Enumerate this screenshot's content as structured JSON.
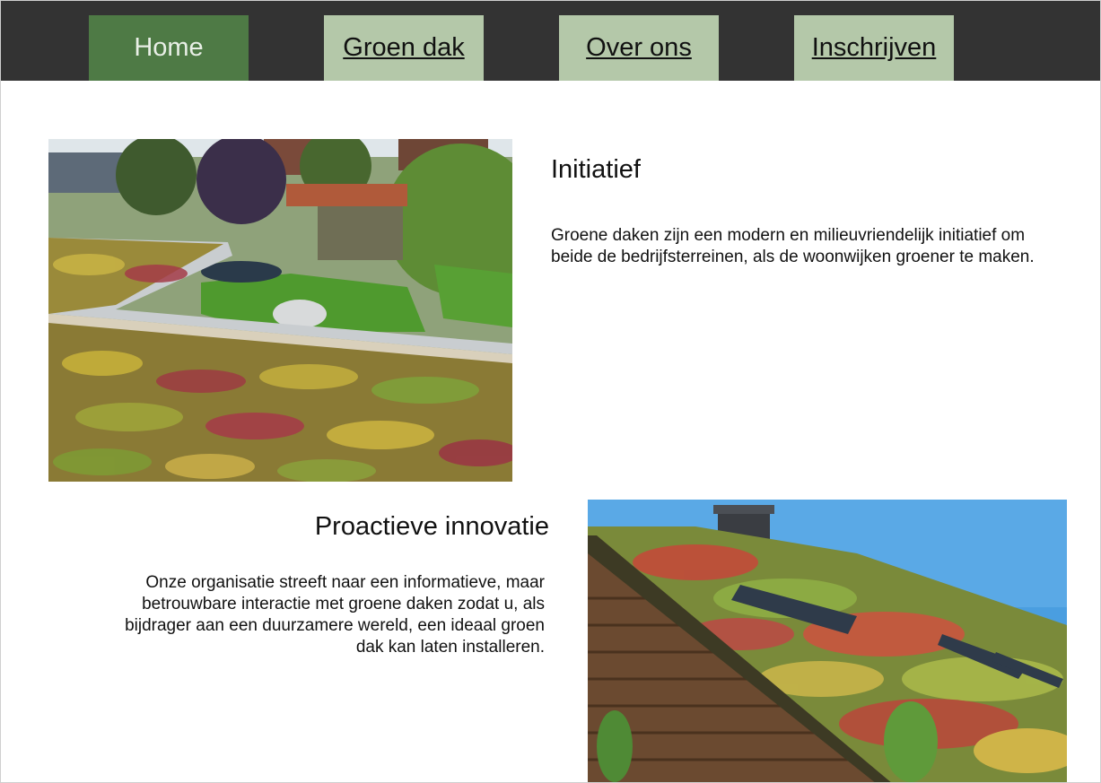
{
  "nav": {
    "items": [
      {
        "label": "Home",
        "active": true
      },
      {
        "label": "Groen dak",
        "active": false
      },
      {
        "label": "Over ons",
        "active": false
      },
      {
        "label": "Inschrijven",
        "active": false
      }
    ]
  },
  "section1": {
    "title": "Initiatief",
    "text": "Groene daken zijn een modern en milieuvriendelijk initiatief om beide de bedrijfsterreinen, als de woonwijken groener te maken.",
    "image": "green-roof-garden-photo"
  },
  "section2": {
    "title": "Proactieve innovatie",
    "text": "Onze organisatie streeft naar een informatieve, maar betrouwbare interactie met groene daken zodat u, als bijdrager aan een duurzamere wereld, een ideaal groen dak kan laten installeren.",
    "image": "green-roof-house-photo"
  },
  "colors": {
    "navbar": "#333333",
    "nav_active": "#4e7a45",
    "nav_inactive": "#b4c8a9"
  }
}
